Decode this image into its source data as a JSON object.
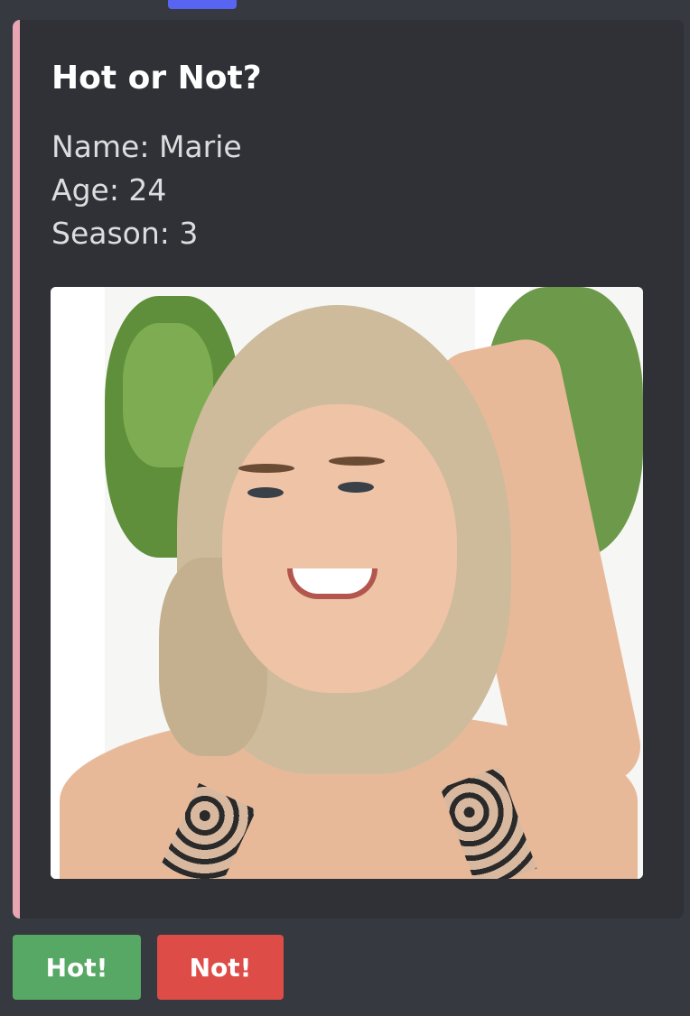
{
  "message": {
    "author": "",
    "timestamp": ""
  },
  "embed": {
    "accent_color": "#e8a6b3",
    "title": "Hot or Not?",
    "fields": {
      "name": "Name: Marie",
      "age": "Age: 24",
      "season": "Season: 3"
    },
    "image": {
      "alt": "Photo of Marie"
    }
  },
  "buttons": {
    "hot_label": "Hot!",
    "hot_color": "#57a865",
    "not_label": "Not!",
    "not_color": "#de4c47"
  },
  "colors": {
    "background": "#36393f",
    "embed_background": "#2f3136",
    "bot_tag": "#5865f2"
  }
}
